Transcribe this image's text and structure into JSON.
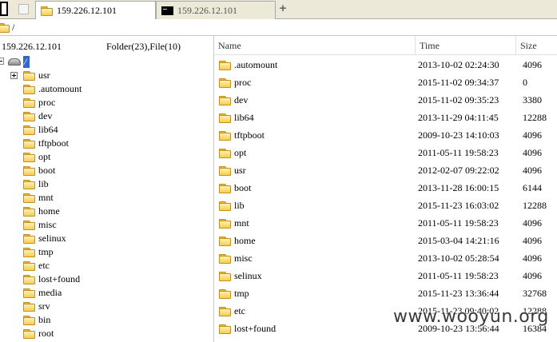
{
  "tabs": [
    {
      "label": "159.226.12.101",
      "icon": "folder-icon",
      "active": true
    },
    {
      "label": "159.226.12.101",
      "icon": "terminal-icon",
      "active": false
    }
  ],
  "add_tab_label": "+",
  "path": "/",
  "left_panel": {
    "host": "159.226.12.101",
    "counts": "Folder(23),File(10)",
    "root_label": "/",
    "tree": [
      {
        "label": "usr"
      },
      {
        "label": ".automount"
      },
      {
        "label": "proc"
      },
      {
        "label": "dev"
      },
      {
        "label": "lib64"
      },
      {
        "label": "tftpboot"
      },
      {
        "label": "opt"
      },
      {
        "label": "boot"
      },
      {
        "label": "lib"
      },
      {
        "label": "mnt"
      },
      {
        "label": "home"
      },
      {
        "label": "misc"
      },
      {
        "label": "selinux"
      },
      {
        "label": "tmp"
      },
      {
        "label": "etc"
      },
      {
        "label": "lost+found"
      },
      {
        "label": "media"
      },
      {
        "label": "srv"
      },
      {
        "label": "bin"
      },
      {
        "label": "root"
      }
    ]
  },
  "file_list": {
    "columns": {
      "name": "Name",
      "time": "Time",
      "size": "Size"
    },
    "rows": [
      {
        "name": ".automount",
        "time": "2013-10-02 02:24:30",
        "size": "4096"
      },
      {
        "name": "proc",
        "time": "2015-11-02 09:34:37",
        "size": "0"
      },
      {
        "name": "dev",
        "time": "2015-11-02 09:35:23",
        "size": "3380"
      },
      {
        "name": "lib64",
        "time": "2013-11-29 04:11:45",
        "size": "12288"
      },
      {
        "name": "tftpboot",
        "time": "2009-10-23 14:10:03",
        "size": "4096"
      },
      {
        "name": "opt",
        "time": "2011-05-11 19:58:23",
        "size": "4096"
      },
      {
        "name": "usr",
        "time": "2012-02-07 09:22:02",
        "size": "4096"
      },
      {
        "name": "boot",
        "time": "2013-11-28 16:00:15",
        "size": "6144"
      },
      {
        "name": "lib",
        "time": "2015-11-23 16:03:02",
        "size": "12288"
      },
      {
        "name": "mnt",
        "time": "2011-05-11 19:58:23",
        "size": "4096"
      },
      {
        "name": "home",
        "time": "2015-03-04 14:21:16",
        "size": "4096"
      },
      {
        "name": "misc",
        "time": "2013-10-02 05:28:54",
        "size": "4096"
      },
      {
        "name": "selinux",
        "time": "2011-05-11 19:58:23",
        "size": "4096"
      },
      {
        "name": "tmp",
        "time": "2015-11-23 13:36:44",
        "size": "32768"
      },
      {
        "name": "etc",
        "time": "2015-11-23 09:40:02",
        "size": "12288"
      },
      {
        "name": "lost+found",
        "time": "2009-10-23 13:56:44",
        "size": "16384"
      }
    ]
  },
  "watermark": "www.wooyun.org"
}
